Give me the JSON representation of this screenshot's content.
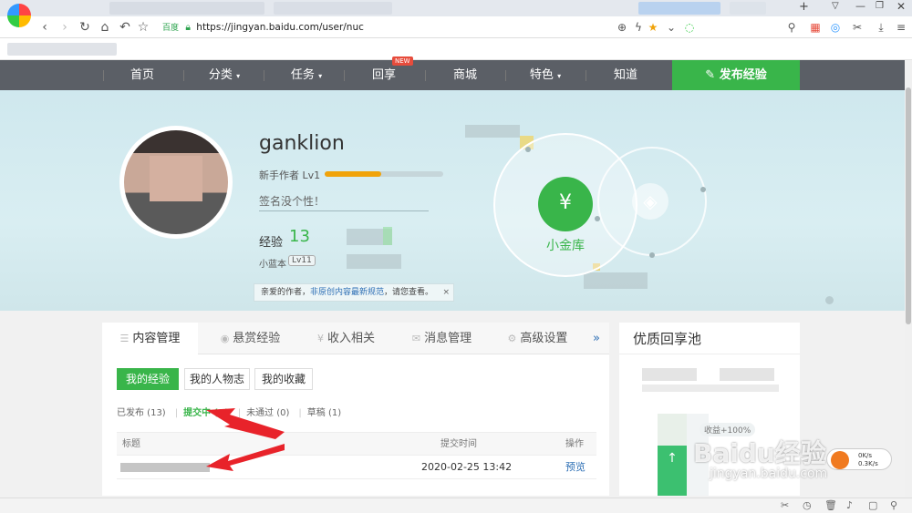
{
  "browser": {
    "url_badge": "百度",
    "url": "https://jingyan.baidu.com/user/nuc"
  },
  "nav": {
    "items": [
      "首页",
      "分类",
      "任务",
      "回享",
      "商城",
      "特色",
      "知道"
    ],
    "new_badge": "NEW",
    "publish": "发布经验"
  },
  "profile": {
    "username": "ganklion",
    "level": "新手作者 Lv1",
    "level_progress": 0.48,
    "signature": "签名没个性！",
    "exp_label": "经验",
    "exp_value": "13",
    "xlb_label": "小蓝本",
    "xlb_level": "Lv11",
    "notice_prefix": "亲爱的作者，",
    "notice_link": "非原创内容最新规范",
    "notice_suffix": "，请您查看。",
    "notice_close": "×",
    "vault_label": "小金库",
    "vault_icon": "¥"
  },
  "tabs": [
    {
      "label": "内容管理",
      "icon": "☰"
    },
    {
      "label": "悬赏经验",
      "icon": "◉"
    },
    {
      "label": "收入相关",
      "icon": "¥"
    },
    {
      "label": "消息管理",
      "icon": "✉"
    },
    {
      "label": "高级设置",
      "icon": "⚙"
    }
  ],
  "tab_more": "»",
  "subtabs": [
    "我的经验",
    "我的人物志",
    "我的收藏"
  ],
  "filters": {
    "published": "已发布 (13)",
    "submitting": "提交中 (1)",
    "rejected": "未通过 (0)",
    "draft": "草稿 (1)"
  },
  "table": {
    "headers": {
      "title": "标题",
      "time": "提交时间",
      "action": "操作"
    },
    "rows": [
      {
        "time": "2020-02-25 13:42",
        "action": "预览"
      }
    ]
  },
  "side": {
    "title": "优质回享池",
    "income": "收益+100%",
    "tank_icon": "↑"
  },
  "watermark": {
    "brand": "Baidu经验",
    "url": "jingyan.baidu.com"
  },
  "speed": {
    "up": "0K/s",
    "down": "0.3K/s"
  },
  "colors": {
    "accent": "#39b54a",
    "nav_bg": "#5b5f66",
    "link": "#2d6fb5",
    "arrow": "#e8232a"
  }
}
